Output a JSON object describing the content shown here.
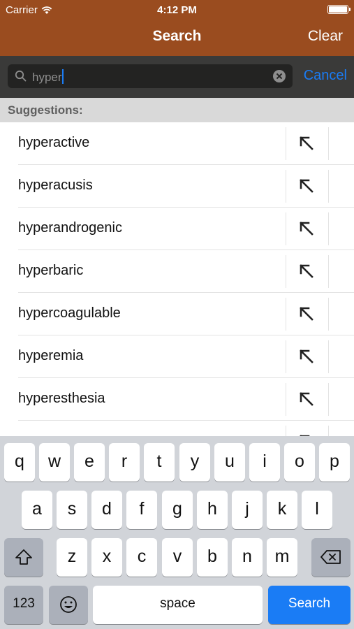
{
  "status": {
    "carrier": "Carrier",
    "time": "4:12 PM"
  },
  "nav": {
    "title": "Search",
    "clear": "Clear"
  },
  "search": {
    "value": "hyper",
    "cancel": "Cancel"
  },
  "section_header": "Suggestions:",
  "suggestions": [
    "hyperactive",
    "hyperacusis",
    "hyperandrogenic",
    "hyperbaric",
    "hypercoagulable",
    "hyperemia",
    "hyperesthesia"
  ],
  "keyboard": {
    "row1": [
      "q",
      "w",
      "e",
      "r",
      "t",
      "y",
      "u",
      "i",
      "o",
      "p"
    ],
    "row2": [
      "a",
      "s",
      "d",
      "f",
      "g",
      "h",
      "j",
      "k",
      "l"
    ],
    "row3": [
      "z",
      "x",
      "c",
      "v",
      "b",
      "n",
      "m"
    ],
    "numbers": "123",
    "space": "space",
    "search": "Search"
  },
  "colors": {
    "nav": "#9a4c1f",
    "accent": "#1a7cf5",
    "searchbar": "#3a3a39"
  }
}
